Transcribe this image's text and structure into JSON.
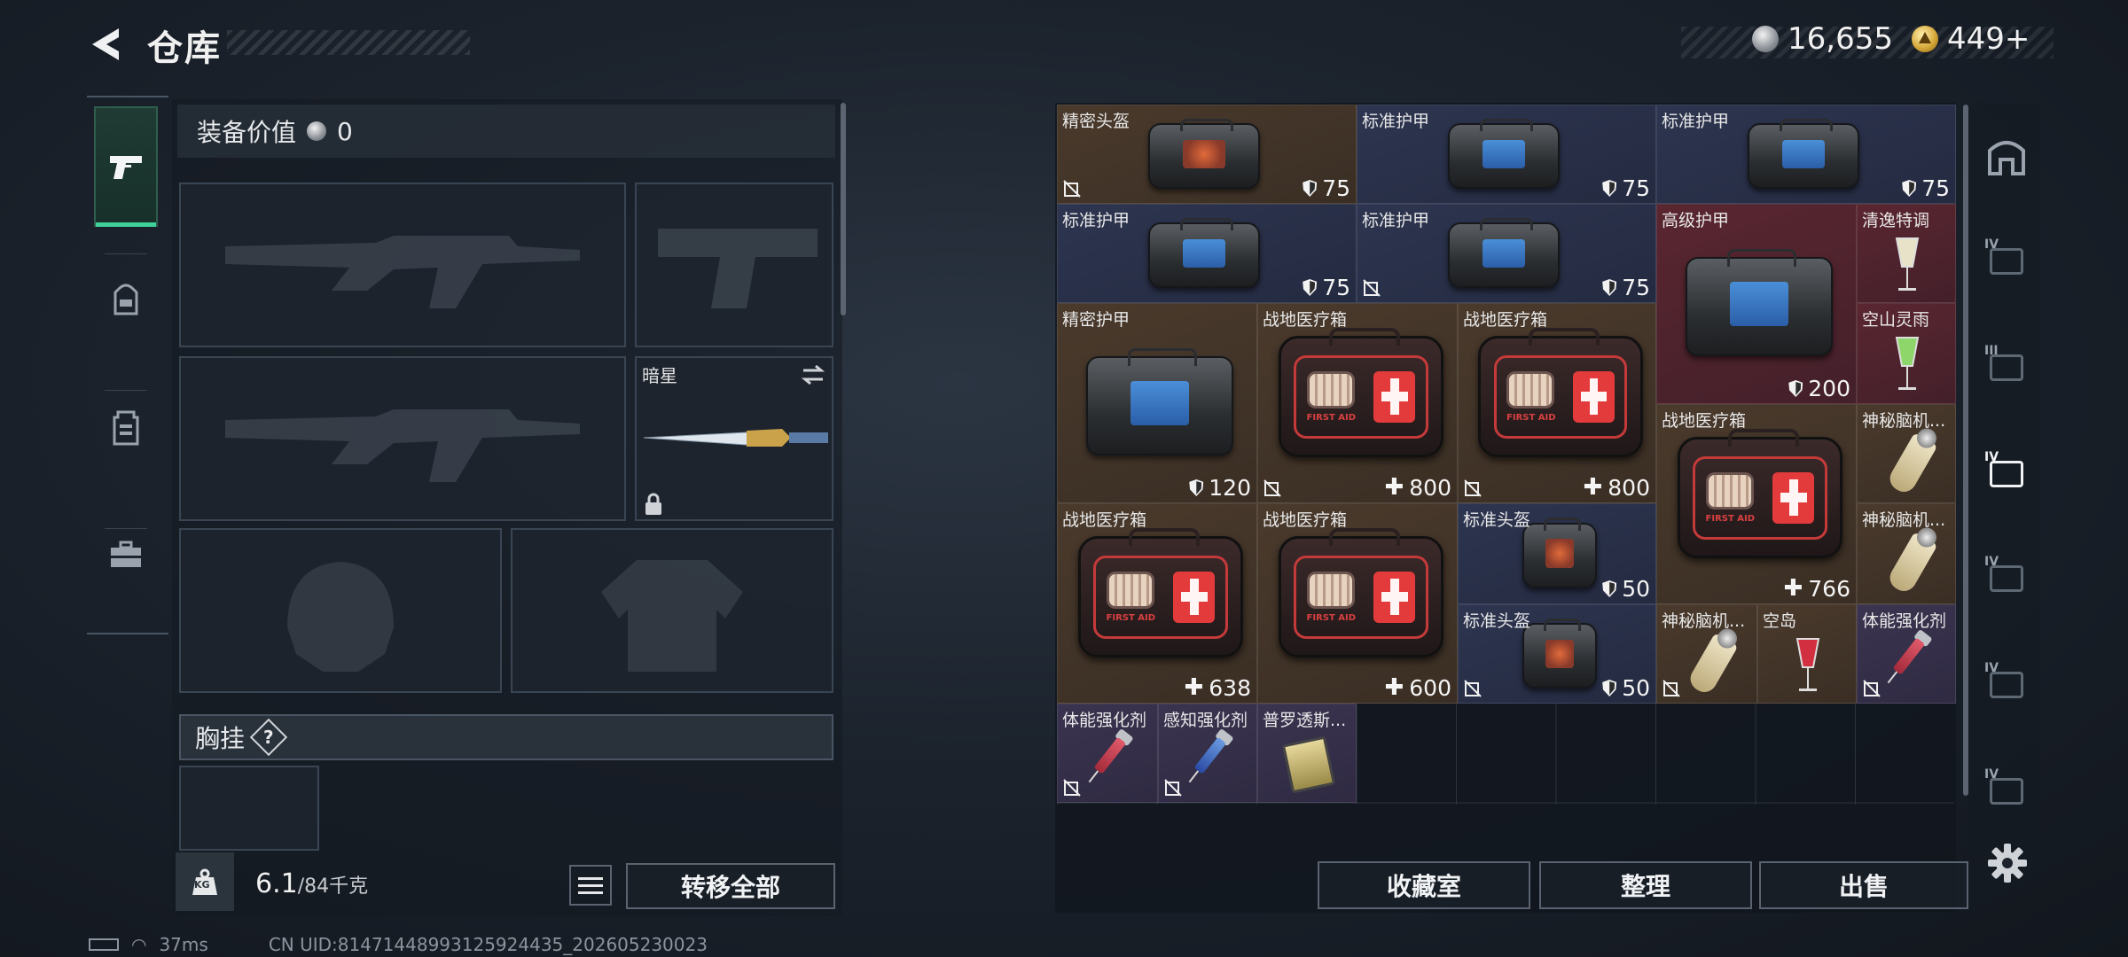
{
  "header": {
    "title": "仓库",
    "silver_amount": "16,655",
    "gold_amount": "449+"
  },
  "equipment": {
    "value_label": "装备价值",
    "value": "0",
    "melee_slot_label": "暗星",
    "chest_rig_label": "胸挂",
    "chest_rig_help": "?",
    "weight_current": "6.1",
    "weight_max": "/84千克",
    "weight_icon_text": "KG",
    "transfer_all_label": "转移全部"
  },
  "inventory": {
    "items": [
      {
        "name": "精密头盔",
        "value": "75"
      },
      {
        "name": "标准护甲",
        "value": "75"
      },
      {
        "name": "标准护甲",
        "value": "75"
      },
      {
        "name": "标准护甲",
        "value": "75"
      },
      {
        "name": "标准护甲",
        "value": "75"
      },
      {
        "name": "高级护甲",
        "value": "200"
      },
      {
        "name": "清逸特调",
        "value": ""
      },
      {
        "name": "空山灵雨",
        "value": ""
      },
      {
        "name": "精密护甲",
        "value": "120"
      },
      {
        "name": "战地医疗箱",
        "value": "800"
      },
      {
        "name": "战地医疗箱",
        "value": "800"
      },
      {
        "name": "战地医疗箱",
        "value": "766"
      },
      {
        "name": "神秘脑机...",
        "value": ""
      },
      {
        "name": "神秘脑机...",
        "value": ""
      },
      {
        "name": "战地医疗箱",
        "value": "638"
      },
      {
        "name": "战地医疗箱",
        "value": "600"
      },
      {
        "name": "标准头盔",
        "value": "50"
      },
      {
        "name": "标准头盔",
        "value": "50"
      },
      {
        "name": "神秘脑机...",
        "value": ""
      },
      {
        "name": "空岛",
        "value": ""
      },
      {
        "name": "体能强化剂",
        "value": ""
      },
      {
        "name": "体能强化剂",
        "value": ""
      },
      {
        "name": "感知强化剂",
        "value": ""
      },
      {
        "name": "普罗透斯...",
        "value": ""
      }
    ],
    "medkit_text": "FIRST AID",
    "buttons": {
      "collection": "收藏室",
      "sort": "整理",
      "sell": "出售"
    }
  },
  "right_rail": [
    "IV",
    "III",
    "IV",
    "IV",
    "IV",
    "IV"
  ],
  "status": {
    "ping": "37ms",
    "uid": "CN UID:8147144899312592443​5_202605230023"
  },
  "colors": {
    "accent": "#3fd19a",
    "brown": "#4a3a2c",
    "blue": "#2d3550",
    "red": "#5a2630"
  }
}
